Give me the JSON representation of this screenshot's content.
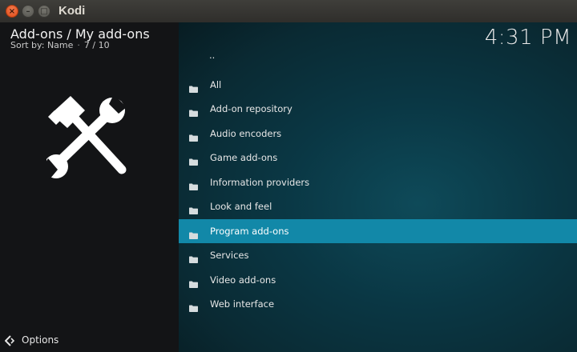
{
  "window": {
    "title": "Kodi",
    "close_glyph": "×",
    "minimize_glyph": "–",
    "maximize_glyph": "□"
  },
  "header": {
    "title": "Add-ons / My add-ons",
    "sort_label": "Sort by: Name",
    "separator": "·",
    "position": "7 / 10"
  },
  "clock": "4:31 PM",
  "main_icon": "tools-hammer-wrench-icon",
  "list": {
    "parent_label": "..",
    "items": [
      {
        "label": "All",
        "icon": "folder-icon"
      },
      {
        "label": "Add-on repository",
        "icon": "folder-icon"
      },
      {
        "label": "Audio encoders",
        "icon": "folder-icon"
      },
      {
        "label": "Game add-ons",
        "icon": "folder-icon"
      },
      {
        "label": "Information providers",
        "icon": "folder-icon"
      },
      {
        "label": "Look and feel",
        "icon": "folder-icon"
      },
      {
        "label": "Program add-ons",
        "icon": "folder-icon",
        "selected": true
      },
      {
        "label": "Services",
        "icon": "folder-icon"
      },
      {
        "label": "Video add-ons",
        "icon": "folder-icon"
      },
      {
        "label": "Web interface",
        "icon": "folder-icon"
      }
    ]
  },
  "footer": {
    "options_label": "Options",
    "options_icon": "options-arrow-icon"
  },
  "colors": {
    "selection": "#1288a8",
    "left_panel": "#131416",
    "right_panel": "#0a3744"
  }
}
